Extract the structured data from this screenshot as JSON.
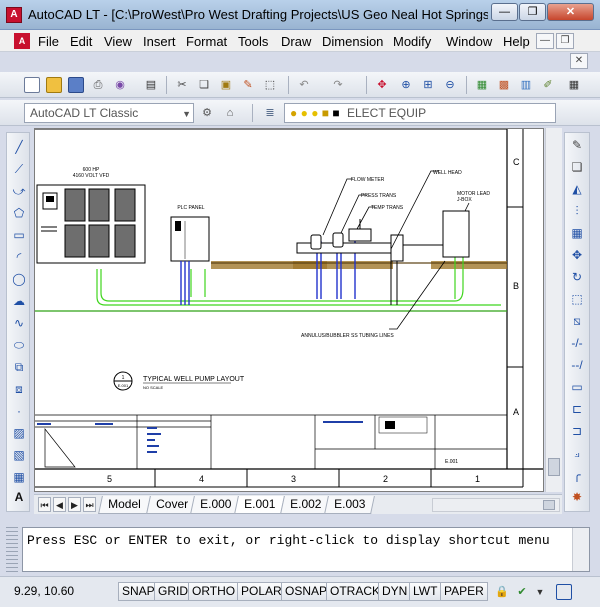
{
  "window": {
    "title": "AutoCAD LT - [C:\\ProWest\\Pro West Drafting Projects\\US Geo Neal Hot Springs\\PC...",
    "app_icon": "autocad-logo-icon",
    "min_label": "—",
    "max_label": "❐",
    "close_label": "✕"
  },
  "menu": {
    "items": [
      "File",
      "Edit",
      "View",
      "Insert",
      "Format",
      "Tools",
      "Draw",
      "Dimension",
      "Modify",
      "Window",
      "Help"
    ],
    "doc_min": "—",
    "doc_restore": "❐",
    "doc_close": "✕"
  },
  "toolbar2": {
    "workspace": "AutoCAD LT Classic",
    "layer": "ELECT EQUIP"
  },
  "drawing": {
    "labels": {
      "hp_motor": "600 HP",
      "vfd": "4160 VOLT VFD",
      "plc_panel": "PLC PANEL",
      "flow_meter": "FLOW METER",
      "press_trans": "PRESS TRANS",
      "temp_trans": "TEMP TRANS",
      "well_head": "WELL HEAD",
      "motor_lead": "MOTOR LEAD",
      "jbox": "J-BOX",
      "annulus": "ANNULUS/BUBBLER SS TUBING LINES",
      "view_title": "TYPICAL WELL PUMP LAYOUT",
      "view_scale": "NO SCALE",
      "bubble_num": "1",
      "bubble_sheet": "E.001",
      "sheet_no": "E.001"
    },
    "grid_cols": [
      "5",
      "4",
      "3",
      "2",
      "1"
    ],
    "grid_rows": [
      "C",
      "B",
      "A"
    ]
  },
  "tabs": [
    "Model",
    "Cover",
    "E.000",
    "E.001",
    "E.002",
    "E.003"
  ],
  "active_tab": "E.001",
  "command_line": "Press ESC or ENTER to exit, or right-click to display shortcut menu",
  "status": {
    "coords": "9.29, 10.60",
    "buttons": [
      "SNAP",
      "GRID",
      "ORTHO",
      "POLAR",
      "OSNAP",
      "OTRACK",
      "DYN",
      "LWT",
      "PAPER"
    ]
  },
  "colors": {
    "accent": "#c8102e",
    "pipe_green": "#3fd51d",
    "conduit_blue": "#2233cc",
    "soil": "#a0782c"
  }
}
